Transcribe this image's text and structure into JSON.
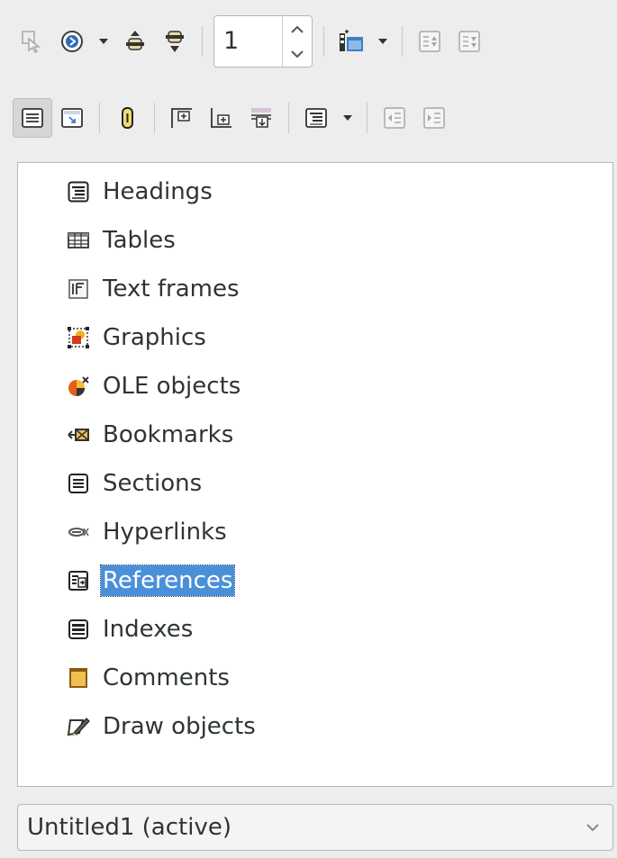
{
  "toolbar_row1": {
    "items": [
      {
        "icon": "toggle-icon",
        "state": "disabled"
      },
      {
        "icon": "navigation-icon"
      },
      {
        "icon": "dropdown-arrow"
      },
      {
        "icon": "previous-item-icon"
      },
      {
        "icon": "next-item-icon"
      },
      {
        "icon": "spin-field"
      },
      {
        "icon": "drag-mode-icon"
      },
      {
        "icon": "dropdown-arrow"
      },
      {
        "icon": "promote-chapter-icon",
        "state": "disabled"
      },
      {
        "icon": "demote-chapter-icon",
        "state": "disabled"
      }
    ],
    "page_number": "1"
  },
  "toolbar_row2": {
    "items": [
      {
        "icon": "content-navigation-view-icon",
        "state": "active"
      },
      {
        "icon": "set-reminder-icon"
      },
      {
        "icon": "headings-shown-icon"
      },
      {
        "icon": "header-icon"
      },
      {
        "icon": "footer-icon"
      },
      {
        "icon": "anchor-icon"
      },
      {
        "icon": "outline-level-icon"
      },
      {
        "icon": "dropdown-arrow"
      },
      {
        "icon": "promote-level-icon",
        "state": "disabled"
      },
      {
        "icon": "demote-level-icon",
        "state": "disabled"
      }
    ]
  },
  "navigator": {
    "items": [
      {
        "label": "Headings",
        "icon": "headings-icon"
      },
      {
        "label": "Tables",
        "icon": "tables-icon"
      },
      {
        "label": "Text frames",
        "icon": "text-frames-icon"
      },
      {
        "label": "Graphics",
        "icon": "graphics-icon"
      },
      {
        "label": "OLE objects",
        "icon": "ole-objects-icon"
      },
      {
        "label": "Bookmarks",
        "icon": "bookmarks-icon"
      },
      {
        "label": "Sections",
        "icon": "sections-icon"
      },
      {
        "label": "Hyperlinks",
        "icon": "hyperlinks-icon"
      },
      {
        "label": "References",
        "icon": "references-icon",
        "selected": true
      },
      {
        "label": "Indexes",
        "icon": "indexes-icon"
      },
      {
        "label": "Comments",
        "icon": "comments-icon"
      },
      {
        "label": "Draw objects",
        "icon": "draw-objects-icon"
      }
    ]
  },
  "document_selector": {
    "value": "Untitled1 (active)"
  },
  "colors": {
    "selection": "#4a90d9",
    "text": "#2e3436",
    "background": "#ededed"
  }
}
